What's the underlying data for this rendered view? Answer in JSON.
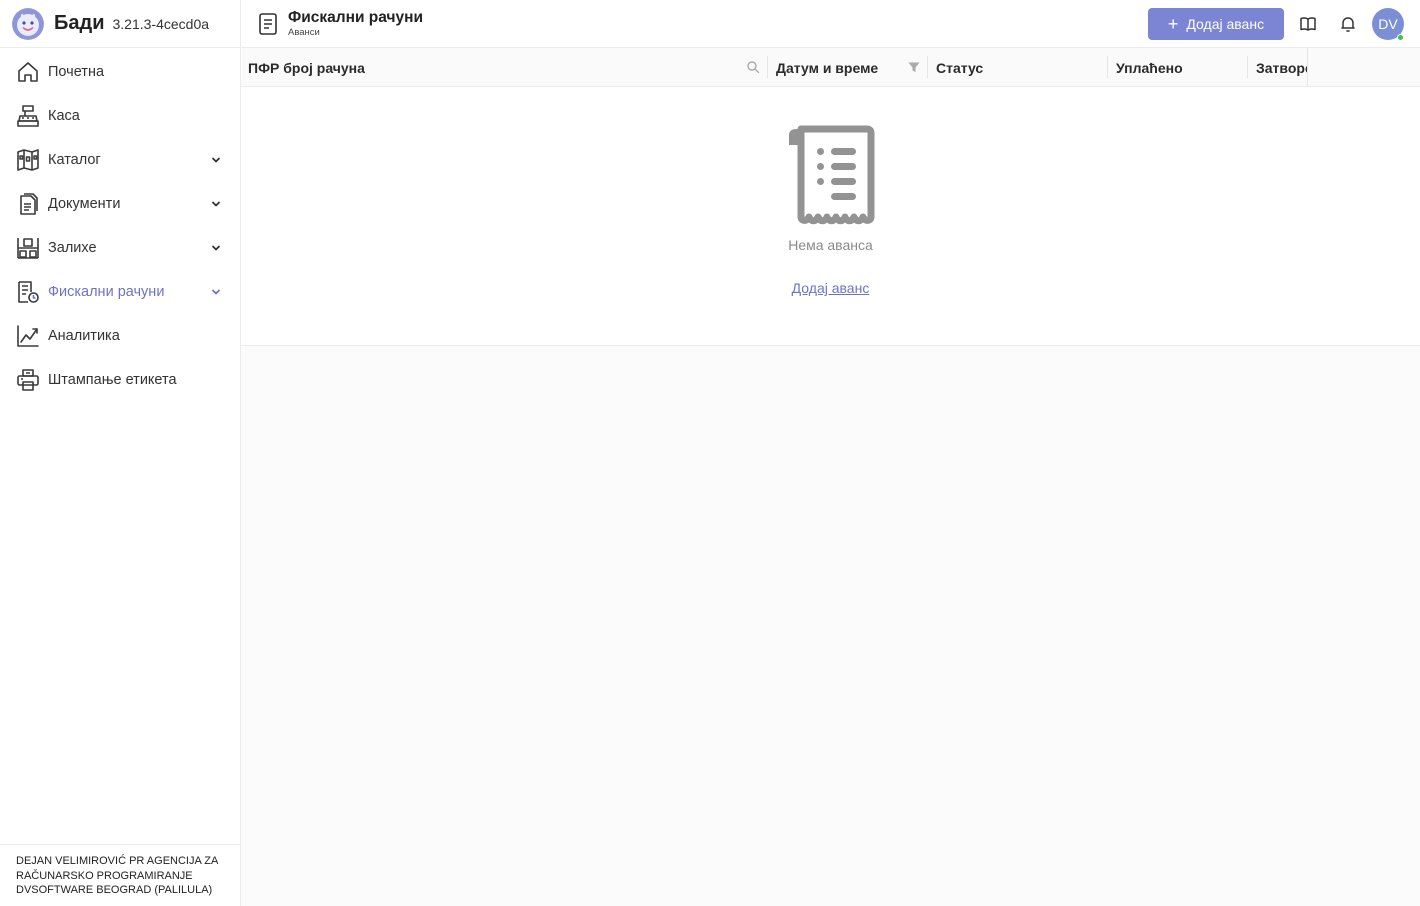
{
  "brand": {
    "name": "Бади",
    "version": "3.21.3-4cecd0a"
  },
  "sidebar": {
    "items": [
      {
        "label": "Почетна",
        "icon": "home-icon"
      },
      {
        "label": "Каса",
        "icon": "cash-register-icon"
      },
      {
        "label": "Каталог",
        "icon": "catalog-icon"
      },
      {
        "label": "Документи",
        "icon": "documents-icon"
      },
      {
        "label": "Залихе",
        "icon": "warehouse-icon"
      },
      {
        "label": "Фискални рачуни",
        "icon": "fiscal-receipt-icon",
        "active": true
      },
      {
        "label": "Аналитика",
        "icon": "analytics-icon"
      },
      {
        "label": "Штампање етикета",
        "icon": "printer-icon"
      }
    ],
    "company": "DEJAN VELIMIROVIĆ PR AGENCIJA ZA RAČUNARSKO PROGRAMIRANJE DVSOFTWARE BEOGRAD (PALILULA)"
  },
  "header": {
    "title": "Фискални рачуни",
    "subtitle": "Аванси",
    "add_button": "Додај аванс",
    "user_initials": "DV"
  },
  "table": {
    "columns": [
      "ПФР број рачуна",
      "Датум и време",
      "Статус",
      "Уплаћено",
      "Затворе"
    ],
    "empty_text": "Нема аванса",
    "empty_action": "Додај аванс"
  },
  "colors": {
    "accent": "#7c85d3",
    "link": "#6b73c8",
    "online": "#3ec53e"
  }
}
